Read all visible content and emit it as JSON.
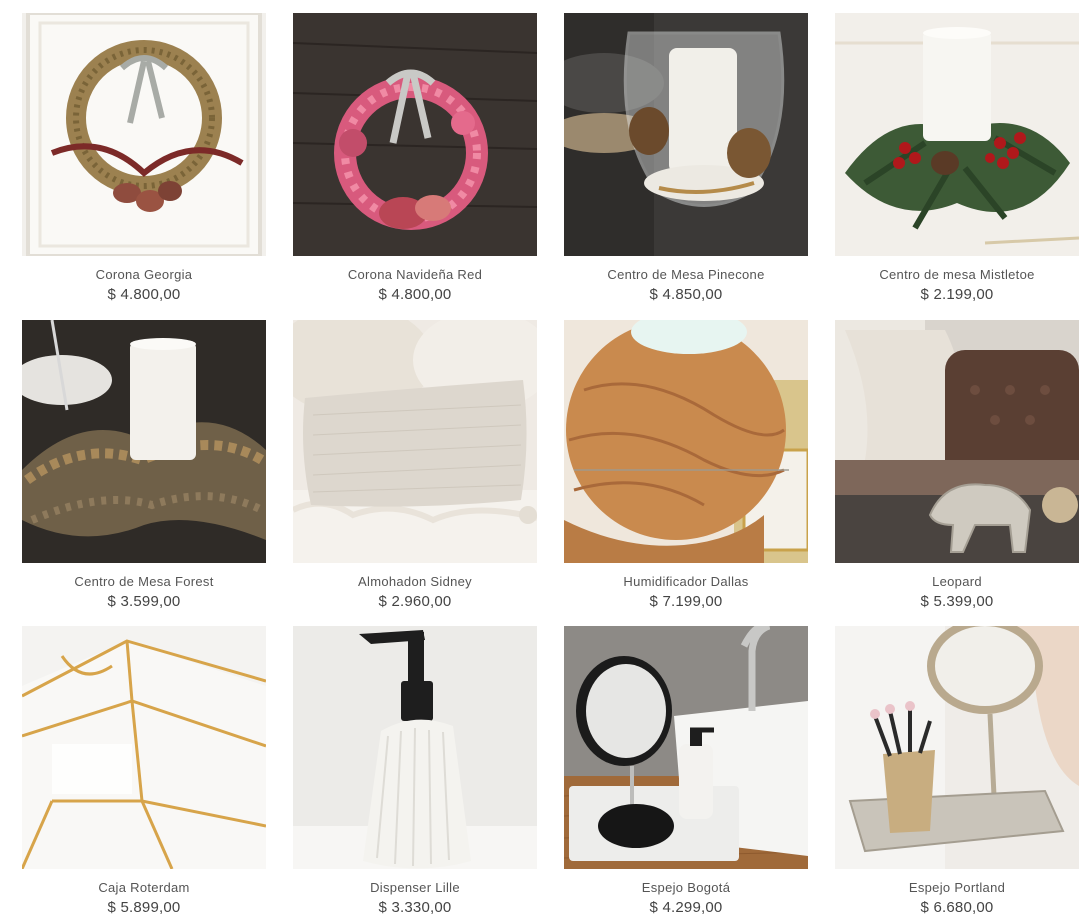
{
  "products": [
    {
      "name": "Corona Georgia",
      "price": "$ 4.800,00",
      "image_icon": "wreath-dried-flowers-image"
    },
    {
      "name": "Corona Navideña Red",
      "price": "$ 4.800,00",
      "image_icon": "wreath-pink-flowers-image"
    },
    {
      "name": "Centro de Mesa Pinecone",
      "price": "$ 4.850,00",
      "image_icon": "glass-candle-pinecone-image"
    },
    {
      "name": "Centro de mesa Mistletoe",
      "price": "$ 2.199,00",
      "image_icon": "candle-mistletoe-image"
    },
    {
      "name": "Centro de Mesa Forest",
      "price": "$ 3.599,00",
      "image_icon": "candle-forest-wreath-image"
    },
    {
      "name": "Almohadon Sidney",
      "price": "$ 2.960,00",
      "image_icon": "cushion-image"
    },
    {
      "name": "Humidificador Dallas",
      "price": "$ 7.199,00",
      "image_icon": "wood-humidifier-image"
    },
    {
      "name": "Leopard",
      "price": "$ 5.399,00",
      "image_icon": "silver-leopard-image"
    },
    {
      "name": "Caja Roterdam",
      "price": "$ 5.899,00",
      "image_icon": "gold-glass-box-image"
    },
    {
      "name": "Dispenser Lille",
      "price": "$ 3.330,00",
      "image_icon": "soap-dispenser-image"
    },
    {
      "name": "Espejo Bogotá",
      "price": "$ 4.299,00",
      "image_icon": "black-mirror-image"
    },
    {
      "name": "Espejo Portland",
      "price": "$ 6.680,00",
      "image_icon": "silver-mirror-image"
    }
  ]
}
